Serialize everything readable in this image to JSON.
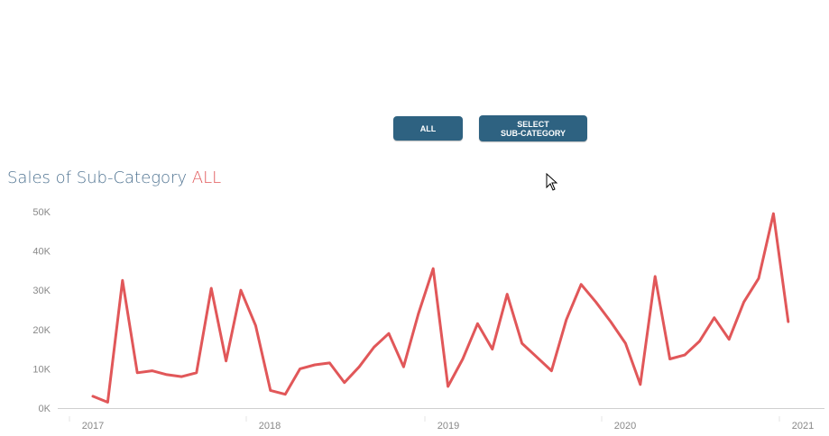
{
  "controls": {
    "all_label": "ALL",
    "select_line1": "SELECT",
    "select_line2": "SUB-CATEGORY"
  },
  "colors": {
    "button_bg": "#2e6281",
    "title": "#4f7391",
    "accent": "#e15759",
    "axis_text": "#888888"
  },
  "chart_title": {
    "prefix": "Sales of Sub-Category ",
    "selection": "ALL"
  },
  "chart_data": {
    "type": "line",
    "title": "Sales of Sub-Category ALL",
    "xlabel": "",
    "ylabel": "",
    "ylim": [
      0,
      50000
    ],
    "y_ticks": [
      0,
      10000,
      20000,
      30000,
      40000,
      50000
    ],
    "y_tick_labels": [
      "0K",
      "10K",
      "20K",
      "30K",
      "40K",
      "50K"
    ],
    "x_tick_labels": [
      "2017",
      "2018",
      "2019",
      "2020",
      "2021"
    ],
    "grid": false,
    "series": [
      {
        "color": "#e15759",
        "x": [
          "2017-01",
          "2017-02",
          "2017-03",
          "2017-04",
          "2017-05",
          "2017-06",
          "2017-07",
          "2017-08",
          "2017-09",
          "2017-10",
          "2017-11",
          "2017-12",
          "2018-01",
          "2018-02",
          "2018-03",
          "2018-04",
          "2018-05",
          "2018-06",
          "2018-07",
          "2018-08",
          "2018-09",
          "2018-10",
          "2018-11",
          "2018-12",
          "2019-01",
          "2019-02",
          "2019-03",
          "2019-04",
          "2019-05",
          "2019-06",
          "2019-07",
          "2019-08",
          "2019-09",
          "2019-10",
          "2019-11",
          "2019-12",
          "2020-01",
          "2020-02",
          "2020-03",
          "2020-04",
          "2020-05",
          "2020-06",
          "2020-07",
          "2020-08",
          "2020-09",
          "2020-10",
          "2020-11",
          "2020-12"
        ],
        "values": [
          3000,
          1500,
          32500,
          9000,
          9500,
          8500,
          8000,
          9000,
          30500,
          12000,
          30000,
          21000,
          4500,
          3500,
          10000,
          11000,
          11500,
          6500,
          10500,
          15500,
          19000,
          10500,
          24000,
          35500,
          5500,
          12500,
          21500,
          15000,
          29000,
          16500,
          13000,
          9500,
          22500,
          31500,
          27000,
          22000,
          16500,
          6000,
          33500,
          12500,
          13500,
          17000,
          23000,
          17500,
          27000,
          33000,
          49500,
          22000
        ]
      }
    ]
  }
}
